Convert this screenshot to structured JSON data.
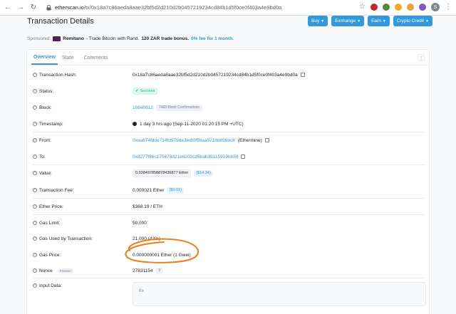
{
  "browser": {
    "url_host": "etherscan.io",
    "url_path": "/tx/0x18a7c86aeda8aae32bf5d2d210d2b0457219234cd84b1d5f0ce0f403a4e9bd0a",
    "profile_initial": "S",
    "icons": [
      "back-icon",
      "forward-icon",
      "reload-icon",
      "lock-icon",
      "star-icon",
      "menu-icon"
    ],
    "extension_colors": [
      "#c62828",
      "#4a8c3a",
      "#f5a623",
      "#e8a33d",
      "#7e57c2"
    ]
  },
  "header": {
    "title": "Transaction Details",
    "buttons": [
      "Buy",
      "Exchange",
      "Earn",
      "Crypto Credit"
    ]
  },
  "sponsored": {
    "label": "Sponsored:",
    "name": "Remitano",
    "text": "- Trade Bitcoin with Rand.",
    "bonus": "120 ZAR trade bonus.",
    "link": "0% fee for 1 month."
  },
  "tabs": [
    "Overview",
    "State",
    "Comments"
  ],
  "fields": {
    "tx_hash_label": "Transaction Hash:",
    "tx_hash": "0x18a7c86aeda8aae32bf5d2d210d2b0457219234cd84b1d5f0ce0f403a4e9bd0a",
    "status_label": "Status:",
    "status": "Success",
    "block_label": "Block:",
    "block": "10840812",
    "confirmations": "7483 Block Confirmations",
    "timestamp_label": "Timestamp:",
    "timestamp": "1 day 3 hrs ago (Sep-11-2020 01:20:15 PM +UTC)",
    "from_label": "From:",
    "from": "0xea674fdde714fd979de3edf0f56aa9716b898ec8",
    "from_name": "(Ethermine)",
    "to_label": "To:",
    "to": "0x8277f66c175673d21e6202cd5bab39115919bb59",
    "value_label": "Value:",
    "value": "0.038497858878436877 Ether",
    "value_usd": "($14.34)",
    "fee_label": "Transaction Fee:",
    "fee": "0.000021 Ether",
    "fee_usd": "($0.01)",
    "ether_price_label": "Ether Price:",
    "ether_price": "$368.19 / ETH",
    "gas_limit_label": "Gas Limit:",
    "gas_limit": "50,000",
    "gas_used_label": "Gas Used by Transaction:",
    "gas_used": "21,000 (42%)",
    "gas_price_label": "Gas Price:",
    "gas_price": "0.000000001 Ether (1 Gwei)",
    "nonce_label": "Nonce",
    "nonce_position": "Position",
    "nonce": "27831154",
    "nonce_index": "0",
    "input_label": "Input Data:",
    "input": "0x"
  },
  "annotation_color": "#f07c1a"
}
